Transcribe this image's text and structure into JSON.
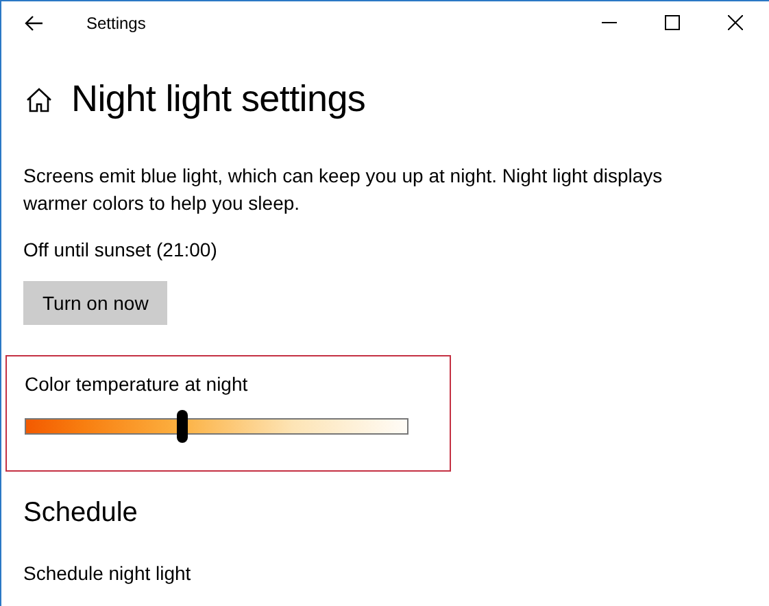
{
  "window": {
    "title": "Settings"
  },
  "page": {
    "title": "Night light settings",
    "description": "Screens emit blue light, which can keep you up at night. Night light displays warmer colors to help you sleep.",
    "status": "Off until sunset (21:00)",
    "button": "Turn on now"
  },
  "color_temperature": {
    "label": "Color temperature at night",
    "level": 0.41,
    "highlighted": true
  },
  "schedule": {
    "heading": "Schedule",
    "label": "Schedule night light"
  }
}
